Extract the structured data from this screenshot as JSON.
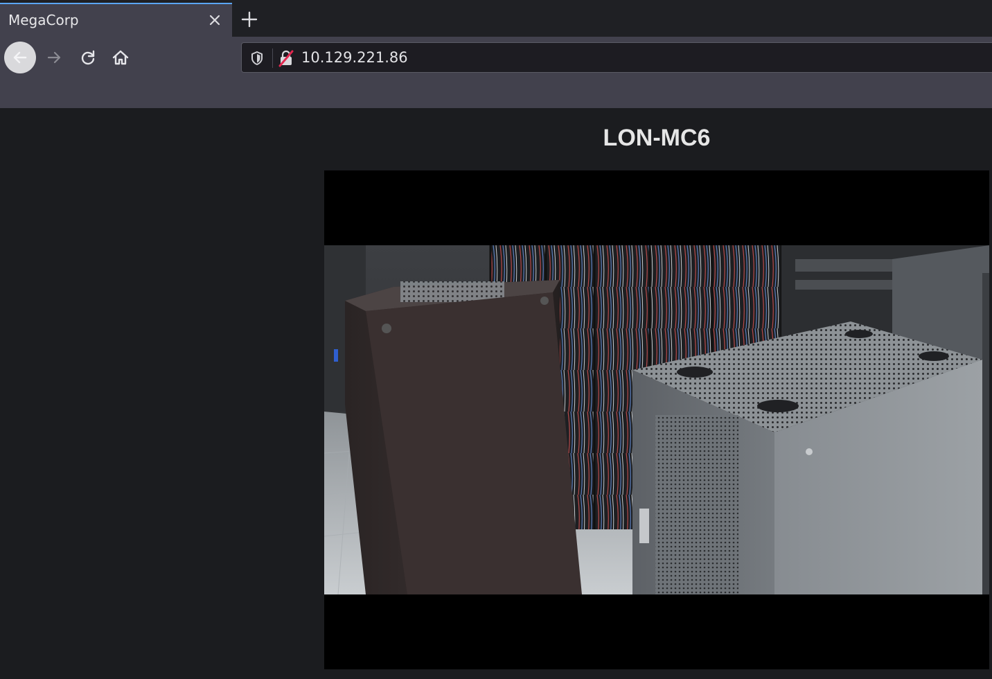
{
  "browser": {
    "tab_title": "MegaCorp",
    "url": "10.129.221.86",
    "icons": {
      "tab_close": "close-icon",
      "new_tab": "plus-icon",
      "back": "arrow-left-icon",
      "forward": "arrow-right-icon",
      "reload": "reload-icon",
      "home": "home-icon",
      "tracking_protection": "shield-icon",
      "connection": "insecure-lock-icon"
    },
    "colors": {
      "accent": "#5aa6f7",
      "insecure": "#e22850"
    }
  },
  "page": {
    "title": "LON-MC6",
    "camera_feed": {
      "subject": "server-room-racks"
    }
  }
}
